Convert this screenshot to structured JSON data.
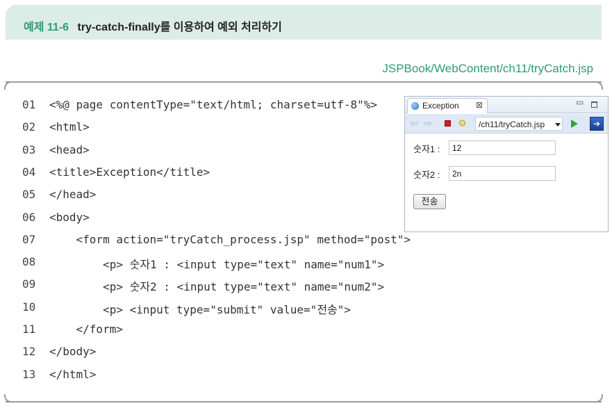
{
  "header": {
    "example_label": "예제",
    "example_number": "11-6",
    "title": "try-catch-finally를 이용하여 예외 처리하기"
  },
  "file_path": "JSPBook/WebContent/ch11/tryCatch.jsp",
  "code_lines": [
    {
      "num": "01",
      "text": "<%@ page contentType=\"text/html; charset=utf-8\"%>"
    },
    {
      "num": "02",
      "text": "<html>"
    },
    {
      "num": "03",
      "text": "<head>"
    },
    {
      "num": "04",
      "text": "<title>Exception</title>"
    },
    {
      "num": "05",
      "text": "</head>"
    },
    {
      "num": "06",
      "text": "<body>"
    },
    {
      "num": "07",
      "text": "    <form action=\"tryCatch_process.jsp\" method=\"post\">"
    },
    {
      "num": "08",
      "text": "        <p> 숫자1 : <input type=\"text\" name=\"num1\">"
    },
    {
      "num": "09",
      "text": "        <p> 숫자2 : <input type=\"text\" name=\"num2\">"
    },
    {
      "num": "10",
      "text": "        <p> <input type=\"submit\" value=\"전송\">"
    },
    {
      "num": "11",
      "text": "    </form>"
    },
    {
      "num": "12",
      "text": "</body>"
    },
    {
      "num": "13",
      "text": "</html>"
    }
  ],
  "browser": {
    "tab_title": "Exception",
    "tab_close_glyph": "⊠",
    "minimize_glyph": "▭",
    "url": "/ch11/tryCatch.jsp",
    "icons": {
      "back": "arrow-left-icon",
      "forward": "arrow-right-icon",
      "stop": "stop-icon",
      "refresh": "refresh-icon",
      "go": "go-icon",
      "external": "external-browser-icon"
    },
    "field1_label": "숫자1 :",
    "field1_value": "12",
    "field2_label": "숫자2 :",
    "field2_value": "2n",
    "submit_label": "전송"
  },
  "colors": {
    "accent_green": "#2f9a77",
    "header_bg": "#dcece7"
  }
}
